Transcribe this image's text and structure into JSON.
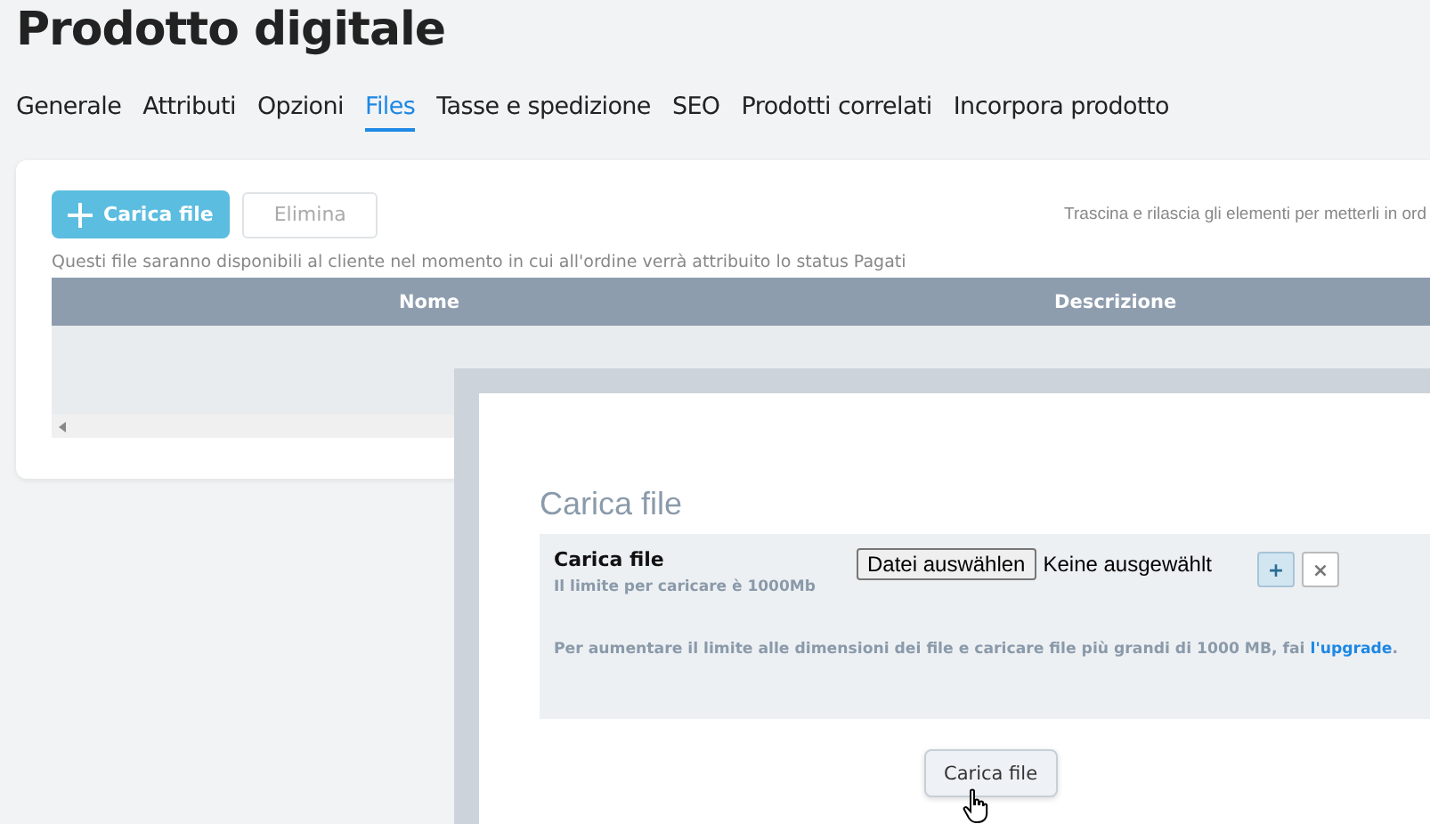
{
  "page_title": "Prodotto digitale",
  "tabs": [
    {
      "label": "Generale",
      "selected": false
    },
    {
      "label": "Attributi",
      "selected": false
    },
    {
      "label": "Opzioni",
      "selected": false
    },
    {
      "label": "Files",
      "selected": true
    },
    {
      "label": "Tasse e spedizione",
      "selected": false
    },
    {
      "label": "SEO",
      "selected": false
    },
    {
      "label": "Prodotti correlati",
      "selected": false
    },
    {
      "label": "Incorpora prodotto",
      "selected": false
    }
  ],
  "toolbar": {
    "upload_button": "Carica file",
    "delete_button": {
      "label": "Elimina",
      "disabled": true
    },
    "drag_hint": "Trascina e rilascia gli elementi per metterli in ord"
  },
  "note": "Questi file saranno disponibili al cliente nel momento in cui all'ordine verrà attribuito lo status Pagati",
  "table": {
    "columns": [
      "Nome",
      "Descrizione"
    ]
  },
  "dialog": {
    "title": "Carica file",
    "field_label": "Carica file",
    "field_hint": "Il limite per caricare è 1000Mb",
    "choose_button": "Datei auswählen",
    "file_status": "Keine ausgewählt",
    "add_button": "+",
    "remove_button": "×",
    "upgrade_text": "Per aumentare il limite alle dimensioni dei file e caricare file più grandi di 1000 MB, fai ",
    "upgrade_link": "l'upgrade",
    "upgrade_end": ".",
    "submit_button": "Carica file"
  }
}
